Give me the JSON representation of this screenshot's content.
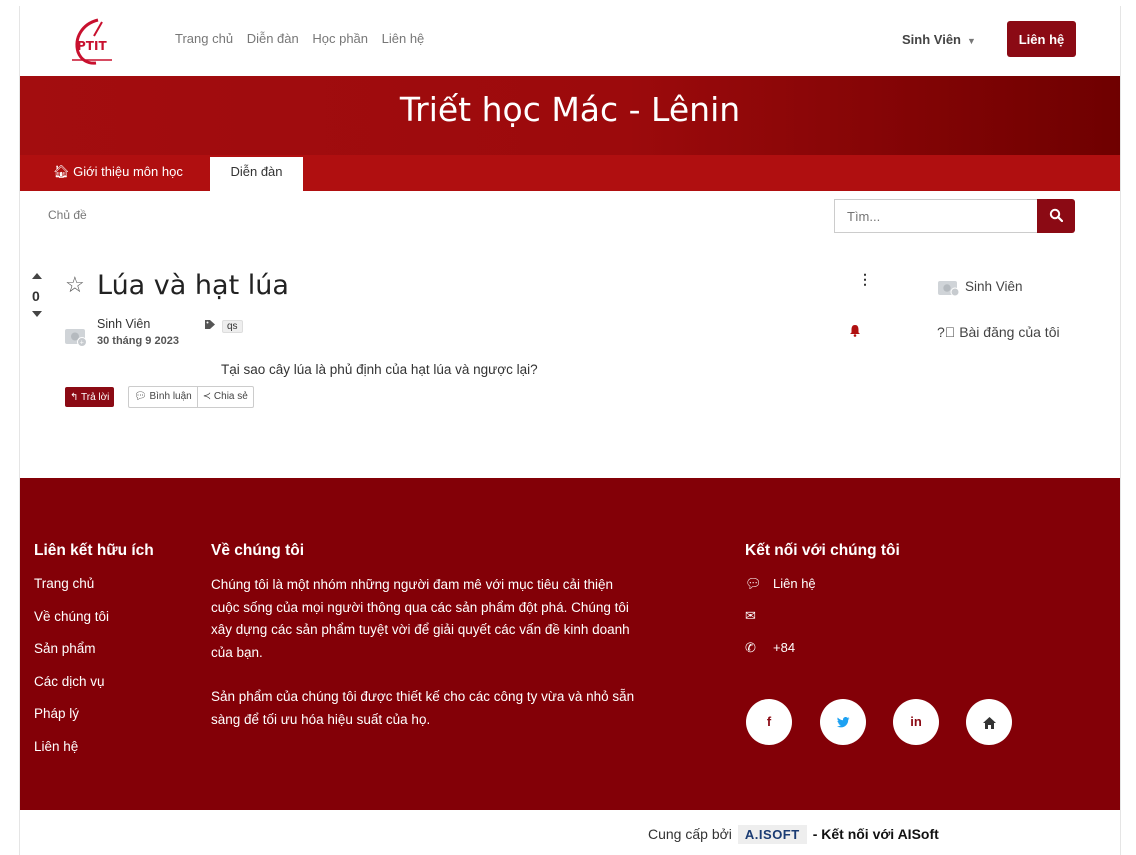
{
  "nav": {
    "logo_text": "PTIT",
    "links": [
      "Trang chủ",
      "Diễn đàn",
      "Học phần",
      "Liên hệ"
    ],
    "user": "Sinh Viên",
    "contact_button": "Liên hệ"
  },
  "course": {
    "title": "Triết học Mác - Lênin",
    "tabs": [
      "Giới thiệu môn học",
      "Diễn đàn"
    ]
  },
  "topic": {
    "label": "Chủ đề",
    "search_placeholder": "Tìm..."
  },
  "post": {
    "votes": "0",
    "title": "Lúa và hạt lúa",
    "author": "Sinh Viên",
    "date": "30 tháng 9 2023",
    "tag": "qs",
    "body": "Tại sao cây lúa là phủ định của hạt lúa và ngược lại?",
    "reply_label": "Trả lời",
    "comment_label": "Bình luận",
    "share_label": "Chia sẻ"
  },
  "sidebar": {
    "user": "Sinh Viên",
    "my_posts": "Bài đăng của tôi"
  },
  "footer": {
    "links_heading": "Liên kết hữu ích",
    "links": [
      "Trang chủ",
      "Về chúng tôi",
      "Sản phẩm",
      "Các dịch vụ",
      "Pháp lý",
      "Liên hệ"
    ],
    "about_heading": "Về chúng tôi",
    "about_p1": "Chúng tôi là một nhóm những người đam mê với mục tiêu cải thiện cuộc sống của mọi người thông qua các sản phẩm đột phá. Chúng tôi xây dựng các sản phẩm tuyệt vời để giải quyết các vấn đề kinh doanh của bạn.",
    "about_p2": "Sản phẩm của chúng tôi được thiết kế cho các công ty vừa và nhỏ sẵn sàng để tối ưu hóa hiệu suất của họ.",
    "connect_heading": "Kết nối với chúng tôi",
    "contact_label": "Liên hệ",
    "phone": "+84",
    "social": [
      "f",
      "t",
      "in",
      "home"
    ]
  },
  "bottom": {
    "provided_by": "Cung cấp bởi",
    "brand": "A.ISOFT",
    "connect": "- Kết nối với AISoft"
  },
  "colors": {
    "primary": "#8b0a14",
    "banner": "#a30d0f",
    "footer": "#830007"
  }
}
